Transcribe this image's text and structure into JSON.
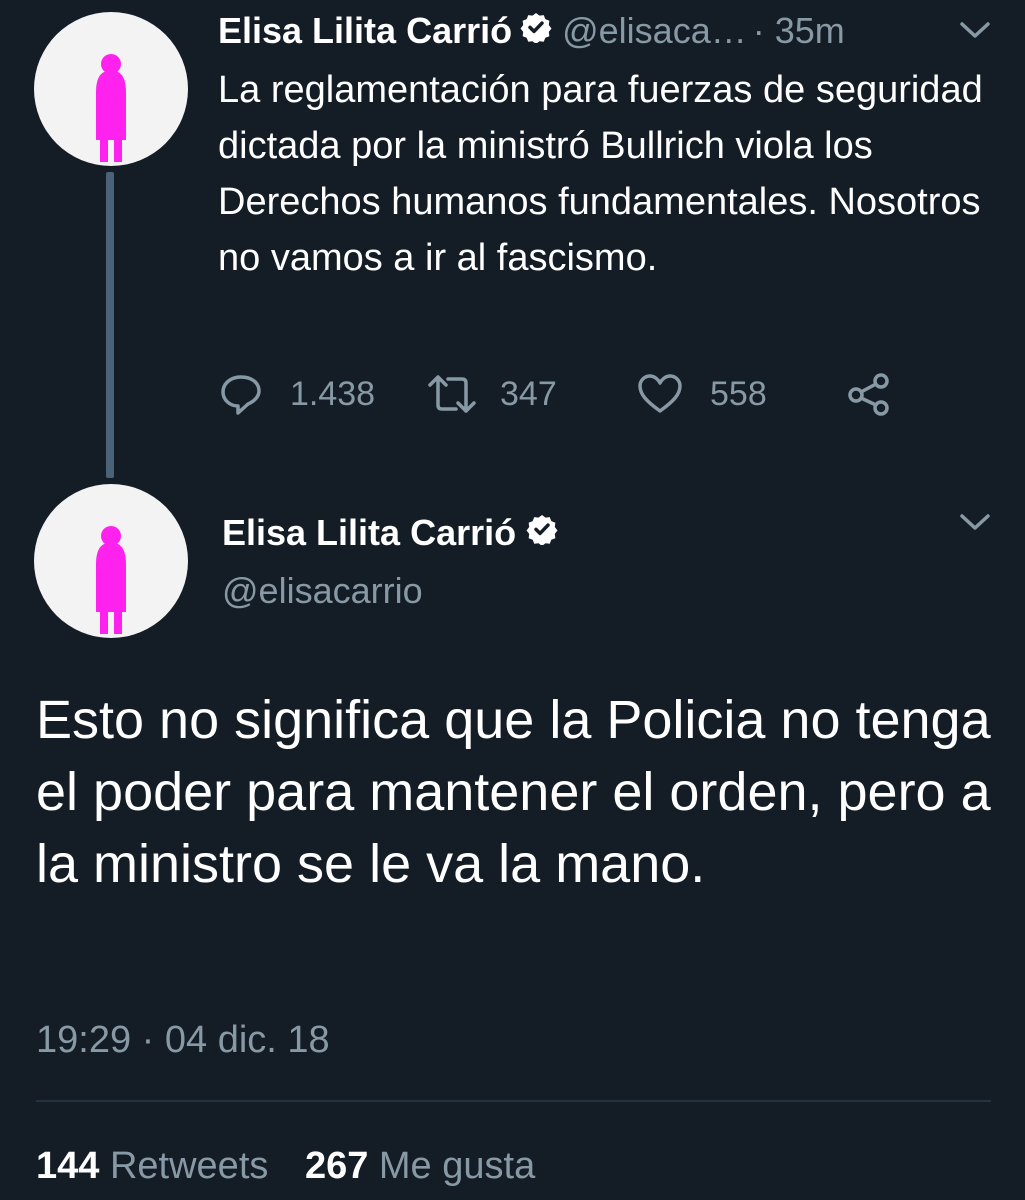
{
  "thread": {
    "tweet1": {
      "author_name": "Elisa Lilita Carrió",
      "handle_truncated": "@elisaca…",
      "time_ago": "· 35m",
      "text": "La reglamentación para fuerzas de seguridad dictada por la ministró Bullrich viola los Derechos humanos fundamentales. Nosotros no vamos a ir al fascismo.",
      "replies": "1.438",
      "retweets": "347",
      "likes": "558"
    },
    "tweet2": {
      "author_name": "Elisa Lilita Carrió",
      "handle": "@elisacarrio",
      "text": "Esto no significa que la Policia no tenga el poder para mantener el orden, pero a la ministro se le va la mano.",
      "timestamp": "19:29 · 04 dic. 18",
      "retweet_count": "144",
      "retweet_label": "Retweets",
      "like_count": "267",
      "like_label": "Me gusta"
    }
  },
  "colors": {
    "background": "#141d26",
    "secondary_text": "#8899a6",
    "avatar_figure": "#ff22ee",
    "thread_line": "#4a6278"
  },
  "icons": {
    "verified": "verified-badge-icon",
    "chevron": "chevron-down-icon",
    "reply": "reply-bubble-icon",
    "retweet": "retweet-arrows-icon",
    "like": "heart-icon",
    "share": "share-icon"
  }
}
